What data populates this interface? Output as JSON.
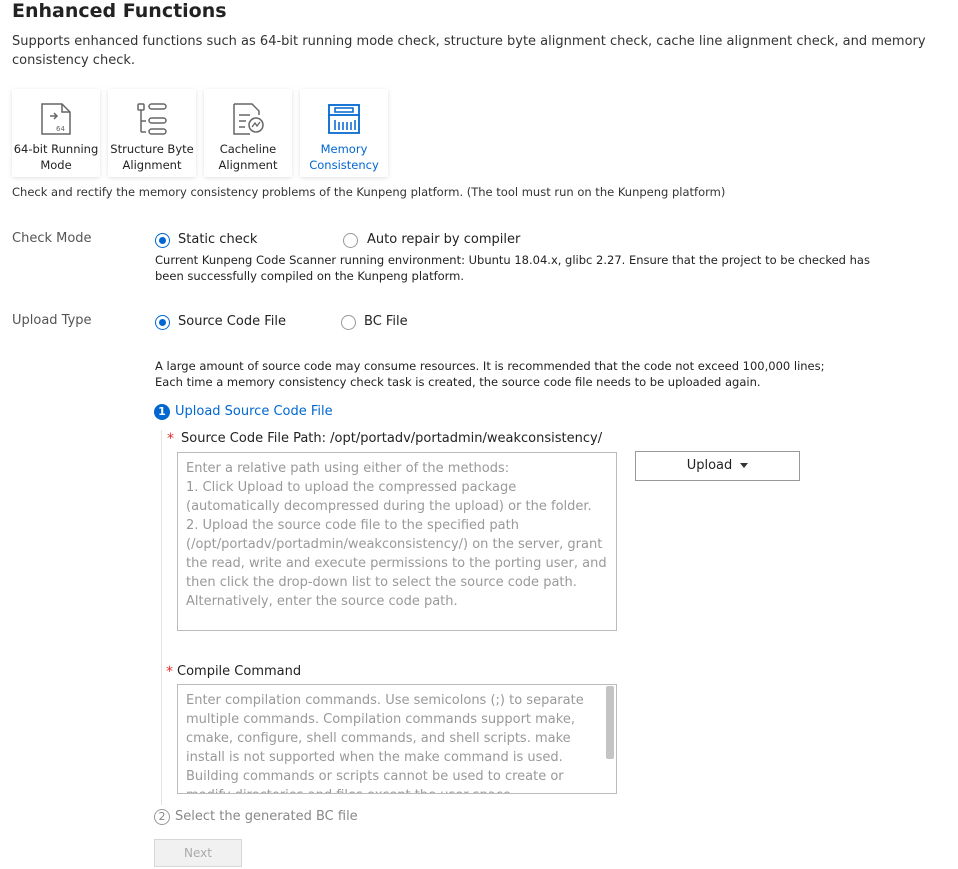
{
  "header": {
    "title": "Enhanced Functions",
    "description": "Supports enhanced functions such as 64-bit running mode check, structure byte alignment check, cache line alignment check, and memory consistency check."
  },
  "cards": [
    {
      "label": "64-bit Running\nMode",
      "icon": "64bit-file-icon",
      "active": false
    },
    {
      "label": "Structure Byte\nAlignment",
      "icon": "structure-list-icon",
      "active": false
    },
    {
      "label": "Cacheline\nAlignment",
      "icon": "cacheline-doc-icon",
      "active": false
    },
    {
      "label": "Memory\nConsistency",
      "icon": "memory-chip-icon",
      "active": true
    }
  ],
  "hint": "Check and rectify the memory consistency problems of the Kunpeng platform. (The tool must run on the Kunpeng platform)",
  "check_mode": {
    "label": "Check Mode",
    "options": [
      "Static check",
      "Auto repair by compiler"
    ],
    "selected": "Static check",
    "note": "Current Kunpeng Code Scanner running environment: Ubuntu 18.04.x, glibc 2.27. Ensure that the project to be checked has been successfully compiled on the Kunpeng platform."
  },
  "upload_type": {
    "label": "Upload Type",
    "options": [
      "Source Code File",
      "BC File"
    ],
    "selected": "Source Code File",
    "note": "A large amount of source code may consume resources. It is recommended that the code not exceed 100,000 lines; Each time a memory consistency check task is created, the source code file needs to be uploaded again."
  },
  "step1": {
    "number": "1",
    "label": "Upload Source Code File",
    "path_label": "Source Code File Path: /opt/portadv/portadmin/weakconsistency/",
    "required_mark": "*",
    "path_placeholder": "Enter a relative path using either of the methods:\n1. Click Upload to upload the compressed package (automatically decompressed during the upload) or the folder.\n2. Upload the source code file to the specified path (/opt/portadv/portadmin/weakconsistency/) on the server, grant the read, write and execute permissions to the porting user, and then click the drop-down list to select the source code path. Alternatively, enter the source code path.",
    "upload_button": "Upload",
    "compile_label": "Compile Command",
    "compile_placeholder": "Enter compilation commands. Use semicolons (;) to separate multiple commands. Compilation commands support make, cmake, configure, shell commands, and shell scripts. make install is not supported when the make command is used. Building commands or scripts cannot be used to create or modify directories and files except the user space."
  },
  "step2": {
    "number": "2",
    "label": "Select the generated BC file"
  },
  "next_button": "Next",
  "colors": {
    "accent": "#0067d1",
    "required": "#e32d2d",
    "disabled_text": "#aaaaaa"
  }
}
